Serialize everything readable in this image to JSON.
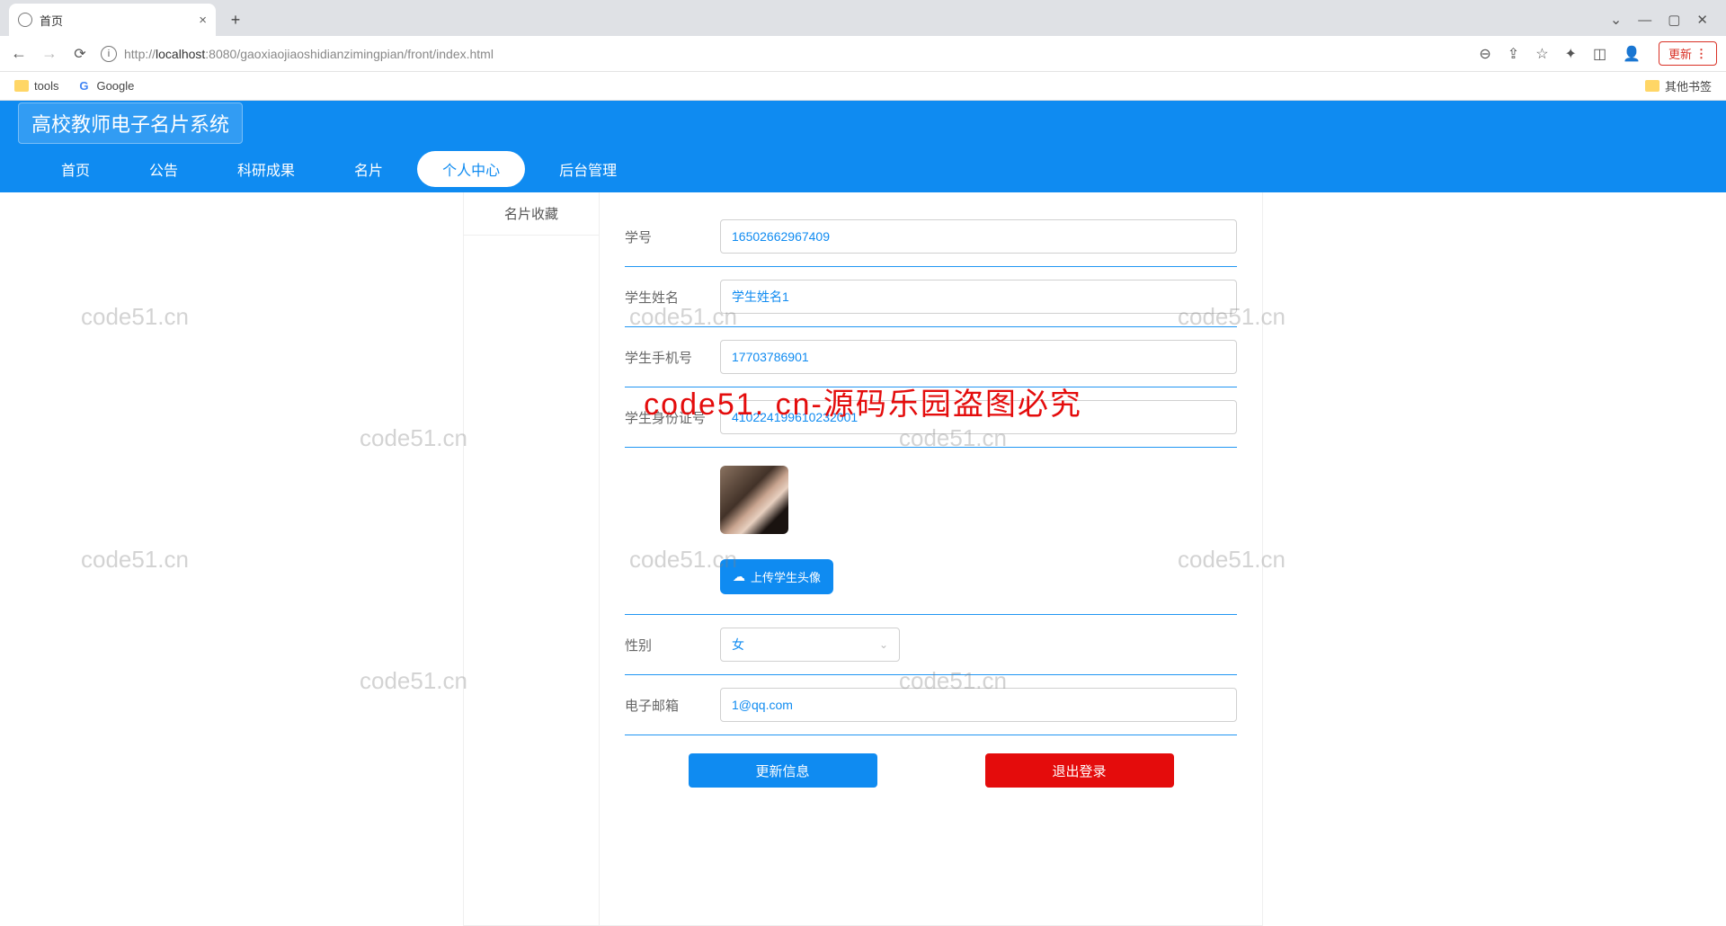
{
  "browser": {
    "tab_title": "首页",
    "url_prefix": "http://",
    "url_host": "localhost",
    "url_path": ":8080/gaoxiaojiaoshidianzimingpian/front/index.html",
    "update_label": "更新",
    "bookmarks": {
      "tools": "tools",
      "google": "Google",
      "other": "其他书签"
    }
  },
  "app": {
    "title": "高校教师电子名片系统",
    "nav": [
      "首页",
      "公告",
      "科研成果",
      "名片",
      "个人中心",
      "后台管理"
    ],
    "nav_active_index": 4,
    "sidebar": {
      "items": [
        "名片收藏"
      ]
    }
  },
  "form": {
    "student_id": {
      "label": "学号",
      "value": "16502662967409"
    },
    "student_name": {
      "label": "学生姓名",
      "value": "学生姓名1"
    },
    "student_phone": {
      "label": "学生手机号",
      "value": "17703786901"
    },
    "student_idcard": {
      "label": "学生身份证号",
      "value": "410224199610232001"
    },
    "upload_label": "上传学生头像",
    "gender": {
      "label": "性别",
      "value": "女"
    },
    "email": {
      "label": "电子邮箱",
      "value": "1@qq.com"
    }
  },
  "buttons": {
    "update": "更新信息",
    "logout": "退出登录"
  },
  "watermark": {
    "text": "code51.cn",
    "red_text": "code51. cn-源码乐园盗图必究"
  }
}
